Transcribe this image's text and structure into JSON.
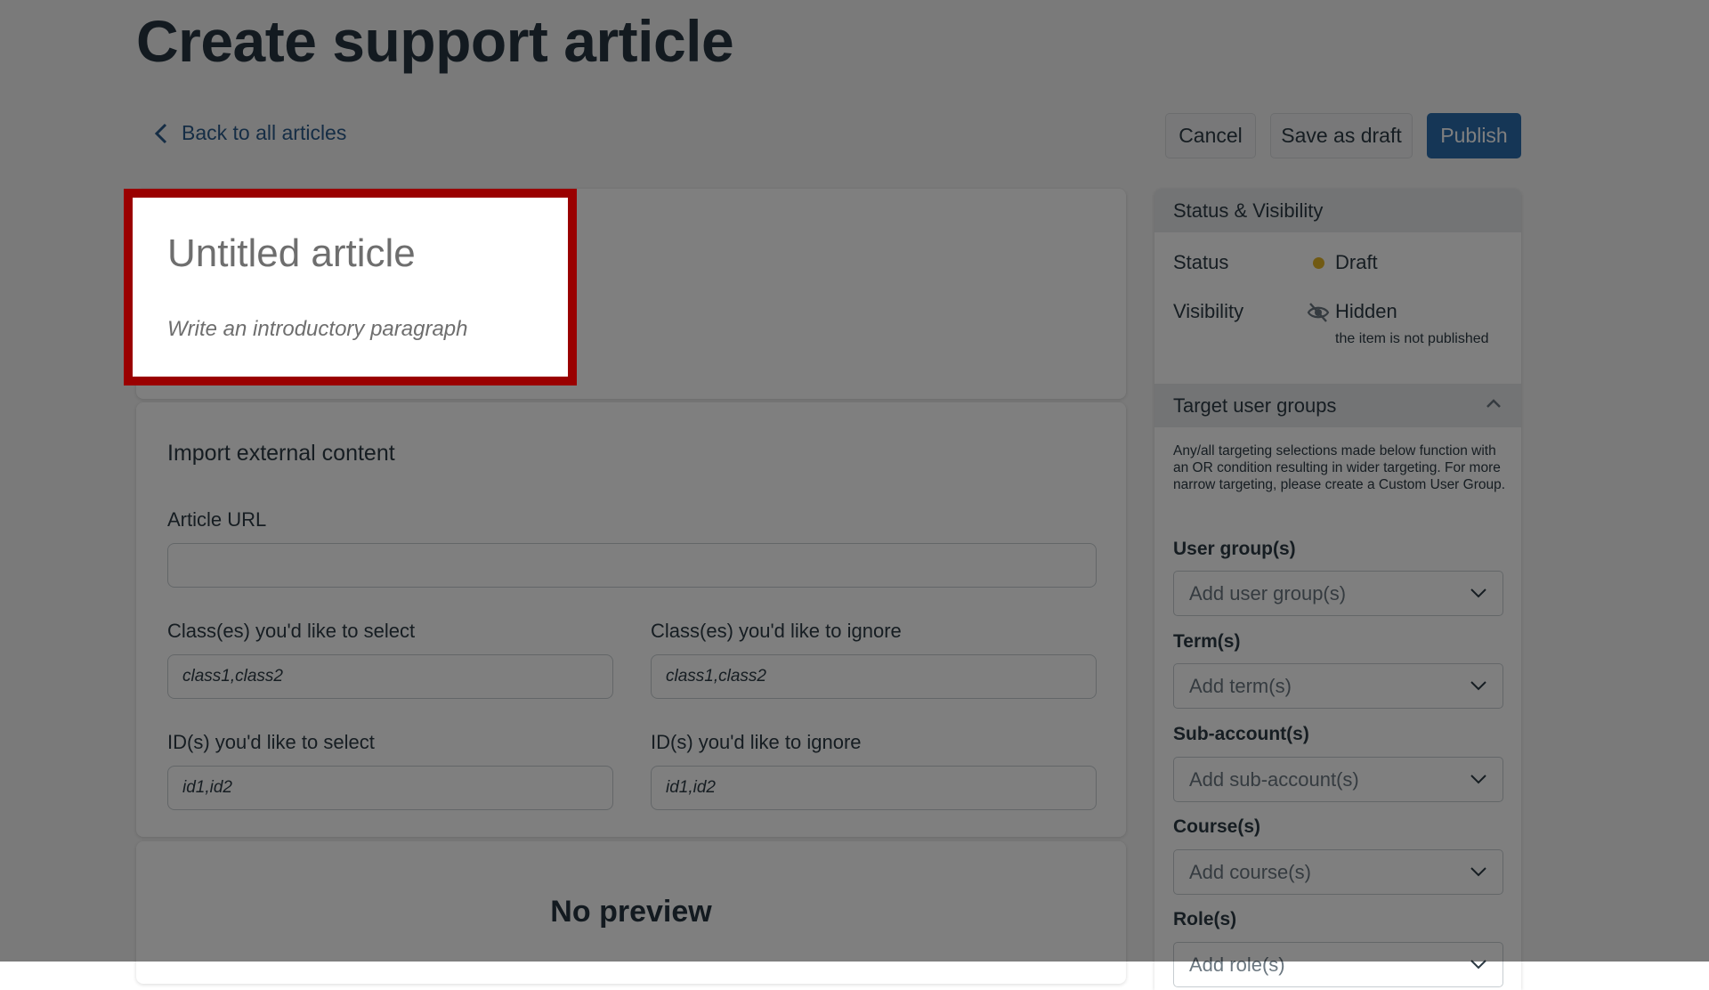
{
  "page": {
    "title": "Create support article",
    "back_link": "Back to all articles"
  },
  "toolbar": {
    "cancel_label": "Cancel",
    "save_draft_label": "Save as draft",
    "publish_label": "Publish",
    "publish_color": "#2b6dad"
  },
  "article": {
    "title_placeholder": "Untitled article",
    "intro_placeholder": "Write an introductory paragraph"
  },
  "import": {
    "section_title": "Import external content",
    "url_label": "Article URL",
    "url_value": "",
    "classes_select_label": "Class(es) you'd like to select",
    "classes_select_placeholder": "class1,class2",
    "classes_ignore_label": "Class(es) you'd like to ignore",
    "classes_ignore_placeholder": "class1,class2",
    "ids_select_label": "ID(s) you'd like to select",
    "ids_select_placeholder": "id1,id2",
    "ids_ignore_label": "ID(s) you'd like to ignore",
    "ids_ignore_placeholder": "id1,id2"
  },
  "preview": {
    "empty_text": "No preview"
  },
  "sidebar": {
    "status_section": {
      "title": "Status & Visibility",
      "status_label": "Status",
      "status_value": "Draft",
      "status_color": "#e3b427",
      "visibility_label": "Visibility",
      "visibility_value": "Hidden",
      "visibility_icon": "eye-slash-icon",
      "visibility_note": "the item is not published"
    },
    "targeting_section": {
      "title": "Target user groups",
      "expanded": true,
      "note": "Any/all targeting selections made below function with an OR condition resulting in wider targeting. For more narrow targeting, please create a Custom User Group.",
      "fields": [
        {
          "label": "User group(s)",
          "placeholder": "Add user group(s)"
        },
        {
          "label": "Term(s)",
          "placeholder": "Add term(s)"
        },
        {
          "label": "Sub-account(s)",
          "placeholder": "Add sub-account(s)"
        },
        {
          "label": "Course(s)",
          "placeholder": "Add course(s)"
        },
        {
          "label": "Role(s)",
          "placeholder": "Add role(s)"
        }
      ]
    }
  },
  "highlight": {
    "color": "#9a0000"
  }
}
